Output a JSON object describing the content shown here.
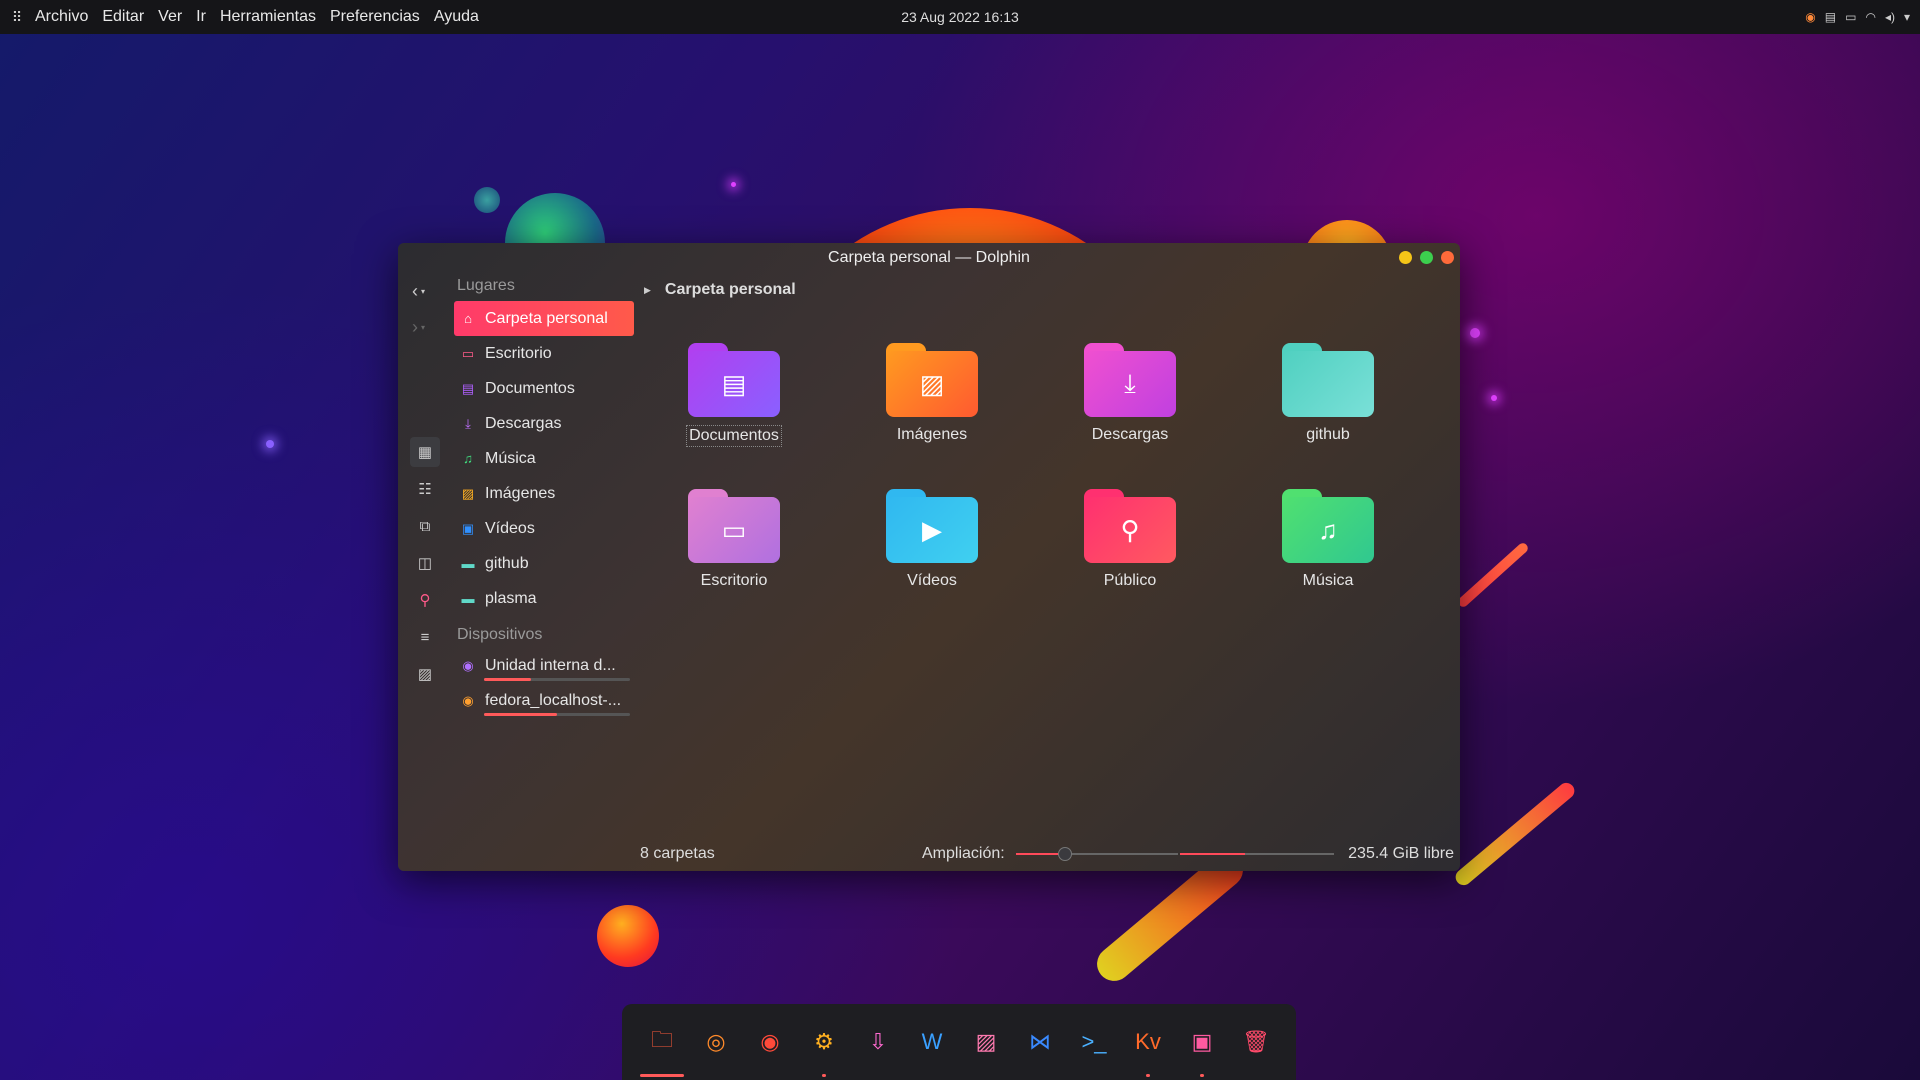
{
  "top_panel": {
    "launcher_icon": "app-grid-icon",
    "menu": [
      "Archivo",
      "Editar",
      "Ver",
      "Ir",
      "Herramientas",
      "Preferencias",
      "Ayuda"
    ],
    "clock": "23 Aug 2022 16:13",
    "tray_icons": [
      "firefox-icon",
      "clipboard-icon",
      "battery-icon",
      "wifi-icon",
      "volume-icon",
      "chevron-down-icon"
    ]
  },
  "window": {
    "title": "Carpeta personal — Dolphin",
    "controls": {
      "minimize_color": "#f5c518",
      "maximize_color": "#3ccf4e",
      "close_color": "#ff6a3a"
    },
    "places_title": "Lugares",
    "places": [
      {
        "label": "Carpeta personal",
        "icon": "home-icon",
        "color": "#ffffff",
        "active": true
      },
      {
        "label": "Escritorio",
        "icon": "desktop-icon",
        "color": "#ff5a8a"
      },
      {
        "label": "Documentos",
        "icon": "document-icon",
        "color": "#b060ff"
      },
      {
        "label": "Descargas",
        "icon": "download-icon",
        "color": "#c070ff"
      },
      {
        "label": "Música",
        "icon": "music-icon",
        "color": "#40e080"
      },
      {
        "label": "Imágenes",
        "icon": "image-icon",
        "color": "#ffb020"
      },
      {
        "label": "Vídeos",
        "icon": "video-icon",
        "color": "#3090ff"
      },
      {
        "label": "github",
        "icon": "folder-icon",
        "color": "#60d8c8"
      },
      {
        "label": "plasma",
        "icon": "folder-icon",
        "color": "#60d8c8"
      }
    ],
    "devices_title": "Dispositivos",
    "devices": [
      {
        "label": "Unidad interna d...",
        "icon": "drive-icon",
        "usage": 0.32
      },
      {
        "label": "fedora_localhost-...",
        "icon": "drive-icon",
        "usage": 0.5
      }
    ],
    "breadcrumb": "Carpeta personal",
    "folders": [
      {
        "label": "Documentos",
        "icon": "document-icon",
        "glyph": "▤",
        "colors": [
          "#b040f0",
          "#8a60ff"
        ],
        "selected": true
      },
      {
        "label": "Imágenes",
        "icon": "image-icon",
        "glyph": "▨",
        "colors": [
          "#ff9a20",
          "#ff5a30"
        ]
      },
      {
        "label": "Descargas",
        "icon": "download-icon",
        "glyph": "⤓",
        "colors": [
          "#f050d0",
          "#c040e0"
        ]
      },
      {
        "label": "github",
        "icon": "folder-icon",
        "glyph": "",
        "colors": [
          "#50d0c0",
          "#7ae0d8"
        ]
      },
      {
        "label": "Escritorio",
        "icon": "desktop-icon",
        "glyph": "▭",
        "colors": [
          "#e080d0",
          "#b070e0"
        ]
      },
      {
        "label": "Vídeos",
        "icon": "video-icon",
        "glyph": "▶",
        "colors": [
          "#30b8f0",
          "#40d0f0"
        ]
      },
      {
        "label": "Público",
        "icon": "user-icon",
        "glyph": "⚲",
        "colors": [
          "#ff3070",
          "#ff5a60"
        ]
      },
      {
        "label": "Música",
        "icon": "music-icon",
        "glyph": "♫",
        "colors": [
          "#50e070",
          "#30c890"
        ]
      }
    ],
    "status": {
      "count": "8 carpetas",
      "zoom_label": "Ampliación:",
      "zoom_level": 0.3,
      "free_fraction": 0.42,
      "free_text": "235.4 GiB libre"
    }
  },
  "dock": [
    {
      "name": "files-icon",
      "glyph": "🗀",
      "color": "#ff5a3a",
      "indicator": "wide"
    },
    {
      "name": "chrome-icon",
      "glyph": "◎",
      "color": "#ff8a2a"
    },
    {
      "name": "firefox-icon",
      "glyph": "◉",
      "color": "#ff4a3a"
    },
    {
      "name": "settings-icon",
      "glyph": "⚙",
      "color": "#ffb020",
      "indicator": "dot"
    },
    {
      "name": "install-icon",
      "glyph": "⇩",
      "color": "#ff6ad0"
    },
    {
      "name": "word-icon",
      "glyph": "W",
      "color": "#3aa0ff"
    },
    {
      "name": "photos-icon",
      "glyph": "▨",
      "color": "#ff7ab0"
    },
    {
      "name": "vscode-icon",
      "glyph": "⋈",
      "color": "#3a8aff"
    },
    {
      "name": "terminal-icon",
      "glyph": ">_",
      "color": "#4ab0ff"
    },
    {
      "name": "kvantum-icon",
      "glyph": "Kv",
      "color": "#ff6a2a",
      "indicator": "dot"
    },
    {
      "name": "screenshot-icon",
      "glyph": "▣",
      "color": "#ff5aa0",
      "indicator": "dot"
    },
    {
      "name": "trash-icon",
      "glyph": "🗑",
      "color": "#ff4a6a"
    }
  ]
}
